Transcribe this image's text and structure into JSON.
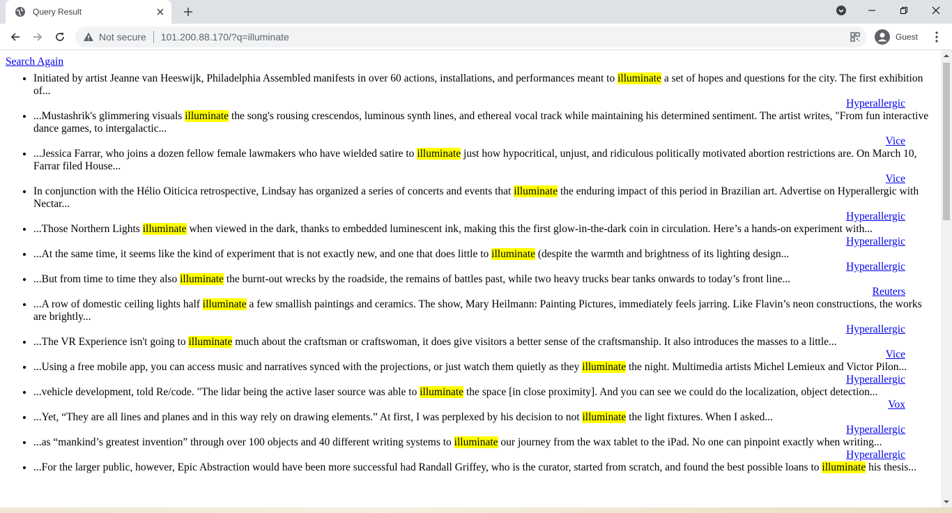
{
  "browser": {
    "tab_title": "Query Result",
    "not_secure_label": "Not secure",
    "url": "101.200.88.170/?q=illuminate",
    "profile_label": "Guest"
  },
  "page": {
    "search_again_label": "Search Again",
    "results": [
      {
        "before": "Initiated by artist Jeanne van Heeswijk, Philadelphia Assembled manifests in over 60 actions, installations, and performances meant to ",
        "term": "illuminate",
        "after": " a set of hopes and questions for the city. The first exhibition of...",
        "source": "Hyperallergic"
      },
      {
        "before": "...Mustashrik's glimmering visuals ",
        "term": "illuminate",
        "after": " the song's rousing crescendos, luminous synth lines, and ethereal vocal track while maintaining his determined sentiment. The artist writes, \"From fun interactive dance games, to intergalactic...",
        "source": "Vice"
      },
      {
        "before": "...Jessica Farrar, who joins a dozen fellow female lawmakers who have wielded satire to ",
        "term": "illuminate",
        "after": " just how hypocritical, unjust, and ridiculous politically motivated abortion restrictions are. On March 10, Farrar filed House...",
        "source": "Vice"
      },
      {
        "before": "In conjunction with the Hélio Oiticica retrospective, Lindsay has organized a series of concerts and events that ",
        "term": "illuminate",
        "after": " the enduring impact of this period in Brazilian art. Advertise on Hyperallergic with Nectar...",
        "source": "Hyperallergic"
      },
      {
        "before": "...Those Northern Lights ",
        "term": "illuminate",
        "after": " when viewed in the dark, thanks to embedded luminescent ink, making this the first glow-in-the-dark coin in circulation. Here’s a hands-on experiment with...",
        "source": "Hyperallergic"
      },
      {
        "before": "...At the same time, it seems like the kind of experiment that is not exactly new, and one that does little to ",
        "term": "illuminate",
        "after": " (despite the warmth and brightness of its lighting design...",
        "source": "Hyperallergic"
      },
      {
        "before": "...But from time to time they also ",
        "term": "illuminate",
        "after": " the burnt-out wrecks by the roadside, the remains of battles past, while two heavy trucks bear tanks onwards to today’s front line...",
        "source": "Reuters"
      },
      {
        "before": "...A row of domestic ceiling lights half ",
        "term": "illuminate",
        "after": " a few smallish paintings and ceramics. The show, Mary Heilmann: Painting Pictures, immediately feels jarring. Like Flavin’s neon constructions, the works are brightly...",
        "source": "Hyperallergic"
      },
      {
        "before": "...The VR Experience isn't going to ",
        "term": "illuminate",
        "after": " much about the craftsman or craftswoman, it does give visitors a better sense of the craftsmanship. It also introduces the masses to a little...",
        "source": "Vice"
      },
      {
        "before": "...Using a free mobile app, you can access music and narratives synced with the projections, or just watch them quietly as they ",
        "term": "illuminate",
        "after": " the night. Multimedia artists Michel Lemieux and Victor Pilon...",
        "source": "Hyperallergic"
      },
      {
        "before": "...vehicle development, told Re/code. \"The lidar being the active laser source was able to ",
        "term": "illuminate",
        "after": " the space [in close proximity]. And you can see we could do the localization, object detection...",
        "source": "Vox"
      },
      {
        "before": "...Yet, “They are all lines and planes and in this way rely on drawing elements.” At first, I was perplexed by his decision to not ",
        "term": "illuminate",
        "after": " the light fixtures. When I asked...",
        "source": "Hyperallergic"
      },
      {
        "before": "...as “mankind’s greatest invention” through over 100 objects and 40 different writing systems to ",
        "term": "illuminate",
        "after": " our journey from the wax tablet to the iPad. No one can pinpoint exactly when writing...",
        "source": "Hyperallergic"
      },
      {
        "before": "...For the larger public, however, Epic Abstraction would have been more successful had Randall Griffey, who is the curator, started from scratch, and found the best possible loans to ",
        "term": "illuminate",
        "after": " his thesis...",
        "source": ""
      }
    ]
  }
}
